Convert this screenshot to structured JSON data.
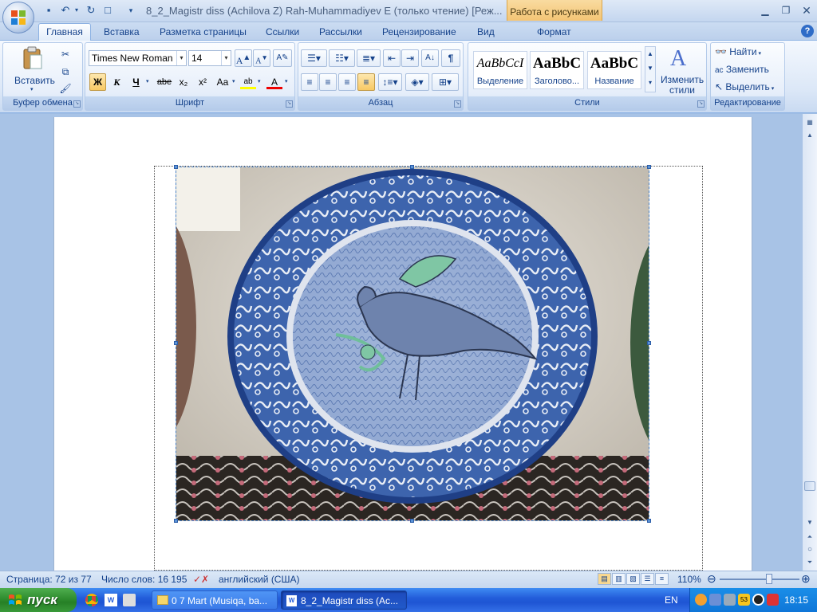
{
  "window": {
    "title": "8_2_Magistr diss (Achilova Z) Rah-Muhammadiyev E (только чтение) [Реж...",
    "context_group": "Работа с рисунками"
  },
  "tabs": [
    "Главная",
    "Вставка",
    "Разметка страницы",
    "Ссылки",
    "Рассылки",
    "Рецензирование",
    "Вид",
    "Формат"
  ],
  "ribbon": {
    "clipboard": {
      "label": "Буфер обмена",
      "paste": "Вставить"
    },
    "font": {
      "label": "Шрифт",
      "family": "Times New Roman",
      "size": "14",
      "bold": "Ж",
      "italic": "К",
      "underline": "Ч",
      "strike": "abe",
      "sub": "x₂",
      "sup": "x²",
      "case": "Aa"
    },
    "paragraph": {
      "label": "Абзац",
      "marks": "¶"
    },
    "styles": {
      "label": "Стили",
      "change_styles": "Изменить стили",
      "items": [
        {
          "sample": "AaBbCcI",
          "name": "Выделение"
        },
        {
          "sample": "AaBbC",
          "name": "Заголово..."
        },
        {
          "sample": "AaBbC",
          "name": "Название"
        }
      ]
    },
    "editing": {
      "label": "Редактирование",
      "find": "Найти",
      "replace": "Заменить",
      "select": "Выделить"
    }
  },
  "status": {
    "page": "Страница: 72 из 77",
    "words": "Число слов: 16 195",
    "language": "английский (США)",
    "zoom": "110%",
    "zoom_fraction": 0.62
  },
  "taskbar": {
    "start": "пуск",
    "items": [
      "0 7 Mart (Musiqa, ba...",
      "8_2_Magistr diss (Ac..."
    ],
    "lang": "EN",
    "clock": "18:15"
  },
  "colors": {
    "accent": "#15428b",
    "context_tab": "#f3c474",
    "taskbar": "#245edb",
    "start": "#2f8d2f"
  }
}
